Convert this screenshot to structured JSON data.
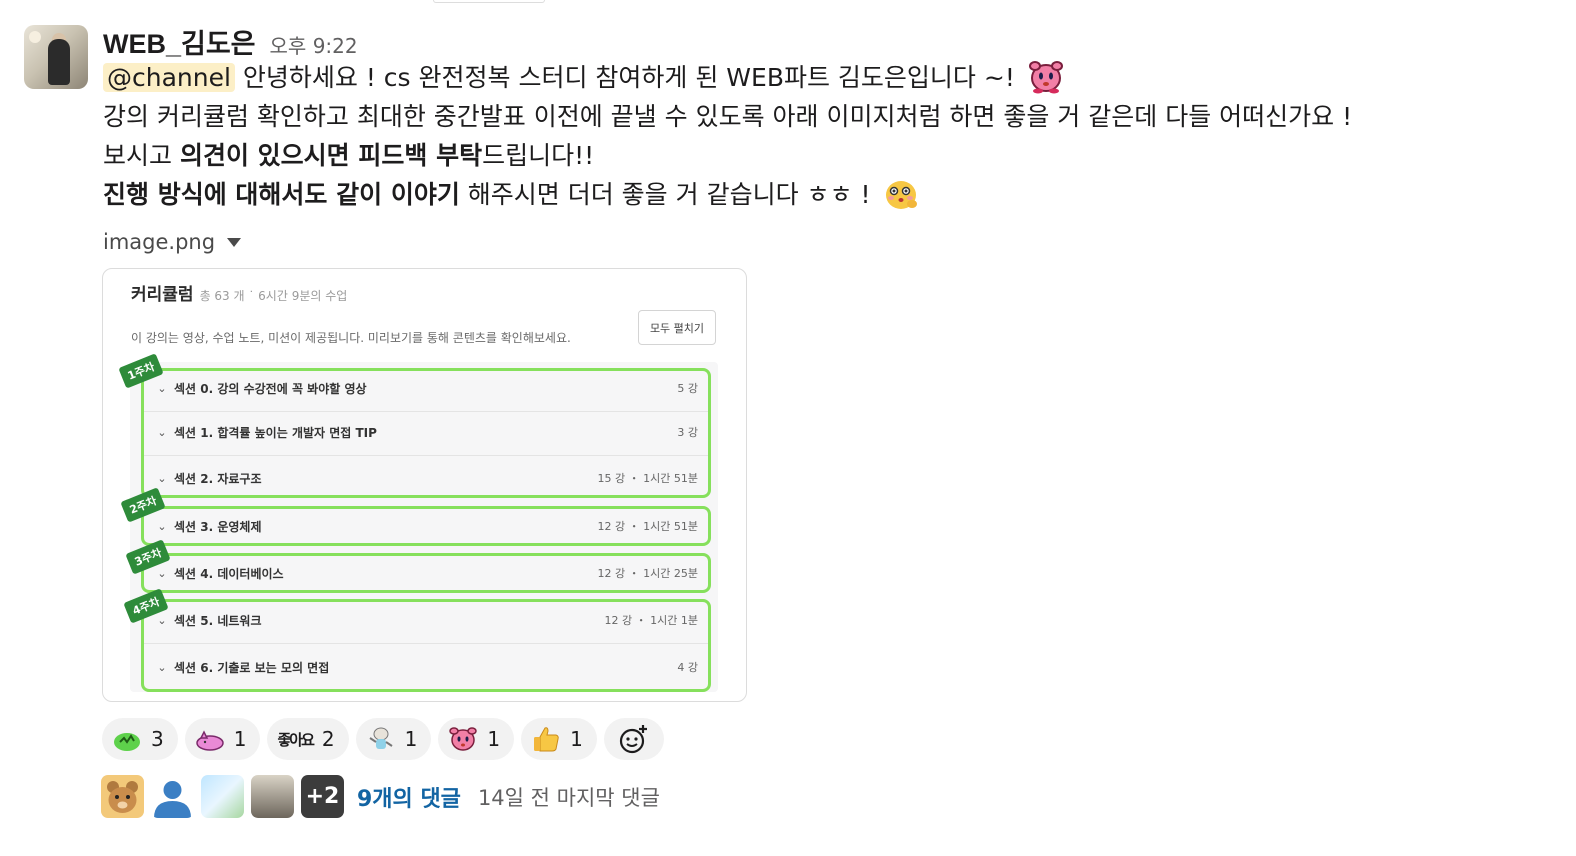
{
  "message": {
    "username": "WEB_김도은",
    "timestamp": "오후 9:22",
    "mention": "@channel",
    "line1_text": " 안녕하세요 ! cs 완전정복 스터디 참여하게 된 WEB파트 김도은입니다 ~!",
    "line2_text": "강의 커리큘럼 확인하고 최대한 중간발표 이전에 끝낼 수 있도록 아래 이미지처럼 하면 좋을 거 같은데 다들 어떠신가요 !",
    "line3_prefix": "보시고 ",
    "line3_bold": "의견이 있으시면 피드백 부탁",
    "line3_suffix": "드립니다!!",
    "line4_bold": "진행 방식에 대해서도 같이 이야기",
    "line4_suffix": " 해주시면 더더 좋을 거 같습니다 ㅎㅎ !",
    "line1_emoji": "kirby-emoji",
    "line4_emoji": "blushing-face-emoji"
  },
  "attachment": {
    "filename": "image.png",
    "curriculum": {
      "title": "커리큘럼",
      "subtitle": "총 63 개 ˙ 6시간 9분의 수업",
      "description": "이 강의는 영상, 수업 노트, 미션이 제공됩니다. 미리보기를 통해 콘텐츠를 확인해보세요.",
      "expand_all": "모두 펼치기",
      "weeks": [
        "1주차",
        "2주차",
        "3주차",
        "4주차"
      ],
      "highlight_color": "#86e05c",
      "week_badge_color": "#2e8b3a",
      "sections": [
        {
          "name": "섹션 0. 강의 수강전에 꼭 봐야할 영상",
          "meta": "5 강"
        },
        {
          "name": "섹션 1. 합격률 높이는 개발자 면접 TIP",
          "meta": "3 강"
        },
        {
          "name": "섹션 2. 자료구조",
          "meta": "15 강 ・ 1시간 51분"
        },
        {
          "name": "섹션 3. 운영체제",
          "meta": "12 강 ・ 1시간 51분"
        },
        {
          "name": "섹션 4. 데이터베이스",
          "meta": "12 강 ・ 1시간 25분"
        },
        {
          "name": "섹션 5. 네트워크",
          "meta": "12 강 ・ 1시간 1분"
        },
        {
          "name": "섹션 6. 기출로 보는 모의 면접",
          "meta": "4 강"
        }
      ]
    }
  },
  "reactions": [
    {
      "emoji": "green-blob-emoji",
      "count": "3"
    },
    {
      "emoji": "pink-cat-emoji",
      "count": "1"
    },
    {
      "emoji": "좋아요",
      "count": "2"
    },
    {
      "emoji": "dancing-cat-emoji",
      "count": "1"
    },
    {
      "emoji": "kirby-emoji",
      "count": "1"
    },
    {
      "emoji": "thumbs-up-emoji",
      "count": "1"
    }
  ],
  "thread": {
    "extra_avatars": "+2",
    "reply_count": "9개의 댓글",
    "last_reply": "14일 전 마지막 댓글"
  },
  "colors": {
    "mention_bg": "#fcefc7",
    "link": "#1264a3",
    "reaction_bg": "#f2f2f2"
  }
}
